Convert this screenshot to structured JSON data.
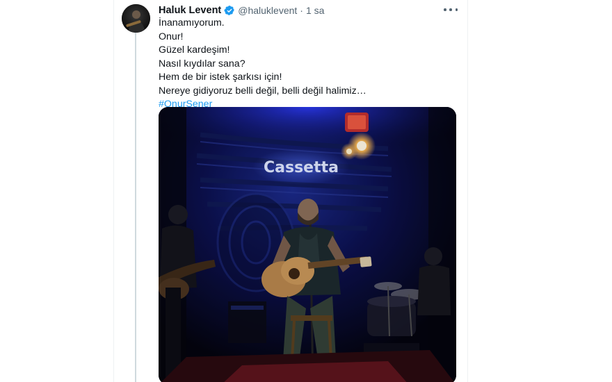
{
  "tweet": {
    "display_name": "Haluk Levent",
    "handle": "@haluklevent",
    "separator": "·",
    "time": "1 sa",
    "lines": [
      "İnanamıyorum.",
      "Onur!",
      "Güzel kardeşim!",
      "Nasıl kıydılar sana?",
      "Hem de bir istek şarkısı için!",
      "Nereye gidiyoruz belli değil, belli değil halimiz…"
    ],
    "hashtag": "#OnurŞener"
  },
  "media": {
    "venue_sign": "Cassetta"
  },
  "icons": {
    "verified": "verified-badge-icon",
    "more": "more-options-icon"
  },
  "colors": {
    "link": "#1d9bf0",
    "verified": "#1d9bf0",
    "text": "#0f1419",
    "secondary": "#536471"
  }
}
